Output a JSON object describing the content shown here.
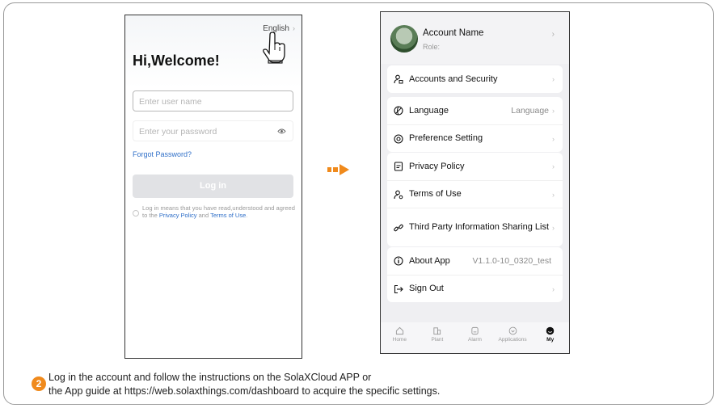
{
  "login_screen": {
    "language": "English",
    "welcome": "Hi,Welcome!",
    "username_placeholder": "Enter user name",
    "password_placeholder": "Enter your password",
    "forgot_password": "Forgot Password?",
    "login_button": "Log in",
    "agreement_prefix": "Log in means that you have read,understood and agreed to the ",
    "privacy_link": "Privacy Policy",
    "agreement_and": " and ",
    "terms_link": "Terms of Use",
    "agreement_suffix": "."
  },
  "my_screen": {
    "account_name": "Account Name",
    "role": "Role:",
    "menu": {
      "accounts_security": "Accounts and Security",
      "language": "Language",
      "language_value": "Language",
      "preference": "Preference Setting",
      "privacy_policy": "Privacy Policy",
      "terms_of_use": "Terms of Use",
      "third_party": "Third Party Information Sharing List",
      "about_app": "About App",
      "about_version": "V1.1.0-10_0320_test",
      "sign_out": "Sign Out"
    },
    "tabs": [
      "Home",
      "Plant",
      "Alarm",
      "Applications",
      "My"
    ]
  },
  "caption": {
    "step_number": "2",
    "line1": "Log in the account and follow the instructions on the SolaXCloud APP or",
    "line2": "the App guide at https://web.solaxthings.com/dashboard to acquire the specific settings."
  },
  "colors": {
    "accent_orange": "#f08a1c",
    "link_blue": "#2f6fc8",
    "login_button_disabled": "#e1e2e5"
  },
  "icons": [
    "hand-pointer-icon",
    "eye-icon",
    "arrow-right-icon",
    "avatar",
    "user-security-icon",
    "language-icon",
    "preference-icon",
    "document-icon",
    "terms-user-icon",
    "link-icon",
    "info-icon",
    "sign-out-icon",
    "home-icon",
    "plant-icon",
    "alarm-icon",
    "applications-icon",
    "my-icon"
  ]
}
